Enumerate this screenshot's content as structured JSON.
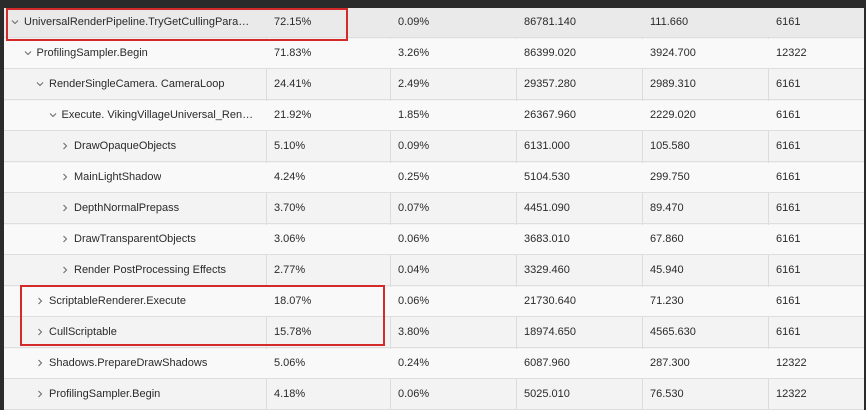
{
  "table": {
    "rows": [
      {
        "name": "UniversalRenderPipeline.TryGetCullingParamet...",
        "total": "72.15%",
        "self": "0.09%",
        "total_ms": "86781.140",
        "self_ms": "111.660",
        "calls": "6161",
        "expanded": true
      },
      {
        "name": "ProfilingSampler.Begin",
        "total": "71.83%",
        "self": "3.26%",
        "total_ms": "86399.020",
        "self_ms": "3924.700",
        "calls": "12322",
        "expanded": true
      },
      {
        "name": "RenderSingleCamera. CameraLoop",
        "total": "24.41%",
        "self": "2.49%",
        "total_ms": "29357.280",
        "self_ms": "2989.310",
        "calls": "6161",
        "expanded": true
      },
      {
        "name": "Execute. VikingVillageUniversal_Rende...",
        "total": "21.92%",
        "self": "1.85%",
        "total_ms": "26367.960",
        "self_ms": "2229.020",
        "calls": "6161",
        "expanded": true
      },
      {
        "name": "DrawOpaqueObjects",
        "total": "5.10%",
        "self": "0.09%",
        "total_ms": "6131.000",
        "self_ms": "105.580",
        "calls": "6161",
        "expanded": false
      },
      {
        "name": "MainLightShadow",
        "total": "4.24%",
        "self": "0.25%",
        "total_ms": "5104.530",
        "self_ms": "299.750",
        "calls": "6161",
        "expanded": false
      },
      {
        "name": "DepthNormalPrepass",
        "total": "3.70%",
        "self": "0.07%",
        "total_ms": "4451.090",
        "self_ms": "89.470",
        "calls": "6161",
        "expanded": false
      },
      {
        "name": "DrawTransparentObjects",
        "total": "3.06%",
        "self": "0.06%",
        "total_ms": "3683.010",
        "self_ms": "67.860",
        "calls": "6161",
        "expanded": false
      },
      {
        "name": "Render PostProcessing Effects",
        "total": "2.77%",
        "self": "0.04%",
        "total_ms": "3329.460",
        "self_ms": "45.940",
        "calls": "6161",
        "expanded": false
      },
      {
        "name": "ScriptableRenderer.Execute",
        "total": "18.07%",
        "self": "0.06%",
        "total_ms": "21730.640",
        "self_ms": "71.230",
        "calls": "6161",
        "expanded": false
      },
      {
        "name": "CullScriptable",
        "total": "15.78%",
        "self": "3.80%",
        "total_ms": "18974.650",
        "self_ms": "4565.630",
        "calls": "6161",
        "expanded": false
      },
      {
        "name": "Shadows.PrepareDrawShadows",
        "total": "5.06%",
        "self": "0.24%",
        "total_ms": "6087.960",
        "self_ms": "287.300",
        "calls": "12322",
        "expanded": false
      },
      {
        "name": "ProfilingSampler.Begin",
        "total": "4.18%",
        "self": "0.06%",
        "total_ms": "5025.010",
        "self_ms": "76.530",
        "calls": "12322",
        "expanded": false
      }
    ]
  },
  "colors": {
    "highlight": "#d42a2a",
    "background": "#f3f3f3"
  },
  "icons": {
    "expanded": "chevron-down-icon",
    "collapsed": "chevron-right-icon"
  }
}
